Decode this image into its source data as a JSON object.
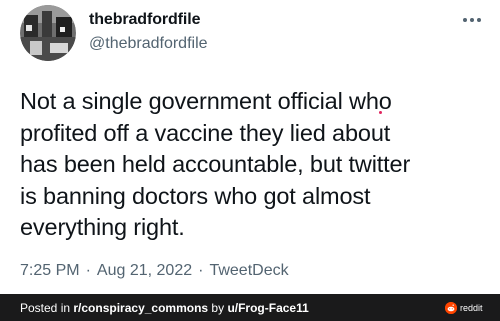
{
  "tweet": {
    "display_name": "thebradfordfile",
    "handle": "@thebradfordfile",
    "text": "Not a single government official who\nprofited off a vaccine they lied about\nhas been held accountable, but twitter\nis banning doctors who got almost\neverything right.",
    "time": "7:25 PM",
    "separator": "·",
    "date": "Aug 21, 2022",
    "source": "TweetDeck"
  },
  "footer": {
    "posted_in_prefix": "Posted in ",
    "subreddit": "r/conspiracy_commons",
    "by_text": " by ",
    "username": "u/Frog-Face11",
    "reddit_label": "reddit"
  },
  "icons": {
    "more": "more-horizontal-icon",
    "reddit": "reddit-logo-icon"
  },
  "colors": {
    "text_primary": "#0f1419",
    "text_secondary": "#536471",
    "footer_bg": "#1a1a1b",
    "reddit_orange": "#ff4500"
  }
}
